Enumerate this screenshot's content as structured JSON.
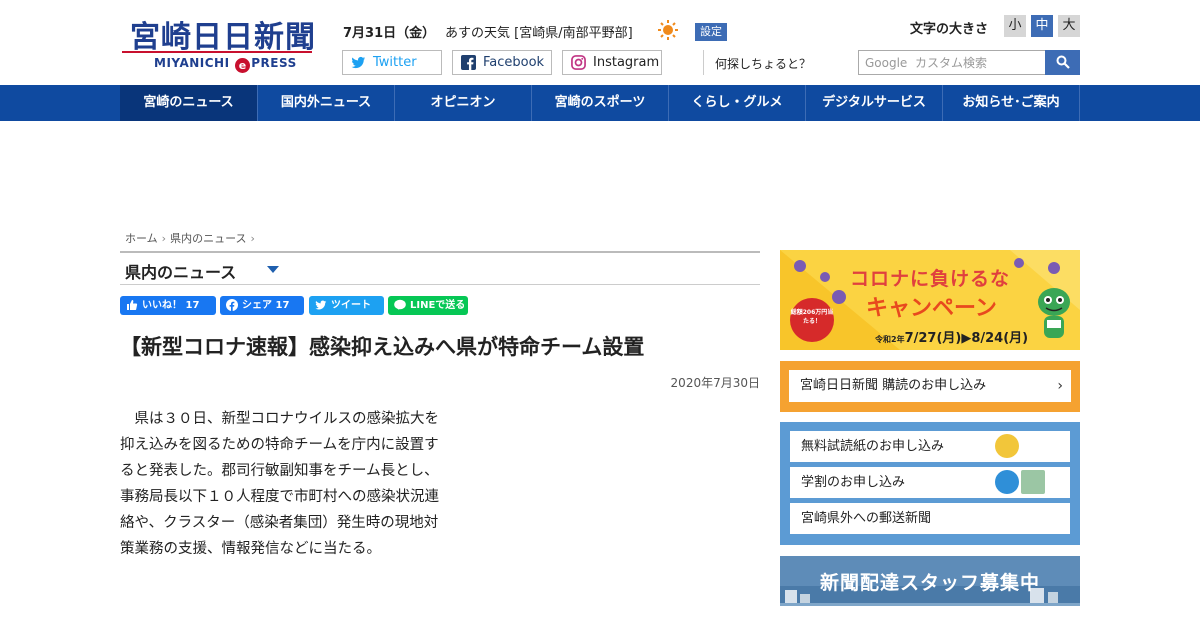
{
  "header": {
    "logo_ja": "宮崎日日新聞",
    "logo_en_left": "MIYANICHI",
    "logo_en_e": "e",
    "logo_en_right": "PRESS",
    "date": "7月31日（金）",
    "weather": "あすの天気 [宮崎県/南部平野部]",
    "weather_icon": "sun-icon",
    "settings_label": "設定",
    "fontsize_label": "文字の大きさ",
    "fontsize_small": "小",
    "fontsize_medium": "中",
    "fontsize_large": "大",
    "social": {
      "twitter": "Twitter",
      "facebook": "Facebook",
      "instagram": "Instagram"
    },
    "question": "何探しちょると？",
    "search_placeholder": "Google  カスタム検索"
  },
  "nav": [
    "宮崎のニュース",
    "国内外ニュース",
    "オピニオン",
    "宮崎のスポーツ",
    "くらし・グルメ",
    "デジタルサービス",
    "お知らせ･ご案内"
  ],
  "breadcrumb": {
    "home": "ホーム",
    "section": "県内のニュース"
  },
  "section_title": "県内のニュース",
  "share": {
    "like": "いいね！ 17",
    "fb_share": "シェア 17",
    "tweet": "ツイート",
    "line": "LINEで送る"
  },
  "article": {
    "title": "【新型コロナ速報】感染抑え込みへ県が特命チーム設置",
    "date": "2020年7月30日",
    "body": "県は３０日、新型コロナウイルスの感染拡大を抑え込みを図るための特命チームを庁内に設置すると発表した。郡司行敏副知事をチーム長とし、事務局長以下１０人程度で市町村への感染状況連絡や、クラスター（感染者集団）発生時の現地対策業務の支援、情報発信などに当たる。"
  },
  "sidebar": {
    "corona_banner": {
      "title": "コロナに負けるな",
      "campaign": "キャンペーン",
      "badge": "総額206万円当たる！",
      "period_prefix": "令和2年",
      "period": "7/27(月)▶8/24(月)"
    },
    "subscribe": "宮崎日日新聞 購読のお申し込み",
    "links": [
      "無料試読紙のお申し込み",
      "学割のお申し込み",
      "宮崎県外への郵送新聞"
    ],
    "recruit": "新聞配達スタッフ募集中"
  },
  "colors": {
    "brand": "#1f3f8f",
    "nav": "#0f4aa0",
    "accent_red": "#c8102e",
    "orange": "#f5a231",
    "blue": "#5c9bd4"
  }
}
